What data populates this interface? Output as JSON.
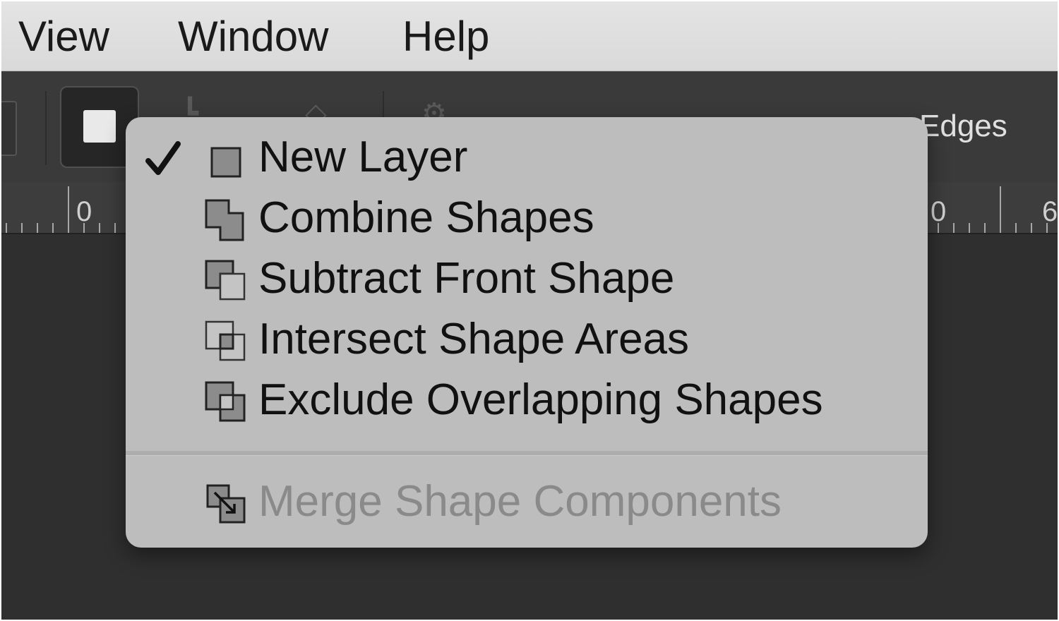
{
  "menubar": {
    "items": [
      {
        "label": "View"
      },
      {
        "label": "Window"
      },
      {
        "label": "Help"
      }
    ]
  },
  "optionsbar": {
    "edges_label": "Edges"
  },
  "ruler": {
    "left_number": "0",
    "right_number": "0",
    "far_right_number": "6"
  },
  "shape_operations_menu": {
    "items": [
      {
        "label": "New Layer",
        "checked": true,
        "enabled": true,
        "icon": "new-layer-icon"
      },
      {
        "label": "Combine Shapes",
        "checked": false,
        "enabled": true,
        "icon": "combine-shapes-icon"
      },
      {
        "label": "Subtract Front Shape",
        "checked": false,
        "enabled": true,
        "icon": "subtract-front-shape-icon"
      },
      {
        "label": "Intersect Shape Areas",
        "checked": false,
        "enabled": true,
        "icon": "intersect-shape-areas-icon"
      },
      {
        "label": "Exclude Overlapping Shapes",
        "checked": false,
        "enabled": true,
        "icon": "exclude-overlapping-shapes-icon"
      },
      {
        "label": "Merge Shape Components",
        "checked": false,
        "enabled": false,
        "icon": "merge-shape-components-icon"
      }
    ]
  },
  "colors": {
    "menu_background": "#bdbdbd",
    "app_background": "#2b2b2b",
    "menubar_background": "#dcdcdc",
    "disabled_text": "#8a8a8a"
  }
}
